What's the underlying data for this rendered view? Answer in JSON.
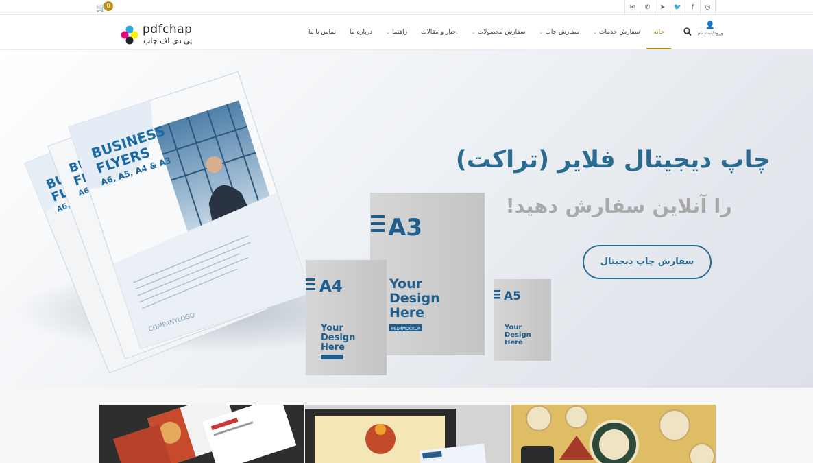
{
  "topbar": {
    "cart_count": "0",
    "social": [
      {
        "icon": "envelope-icon",
        "glyph": "✉"
      },
      {
        "icon": "phone-icon",
        "glyph": "✆"
      },
      {
        "icon": "telegram-icon",
        "glyph": "➤"
      },
      {
        "icon": "twitter-icon",
        "glyph": "🐦"
      },
      {
        "icon": "facebook-icon",
        "glyph": "f"
      },
      {
        "icon": "instagram-icon",
        "glyph": "◎"
      }
    ]
  },
  "header": {
    "logo_en": "pdfchap",
    "logo_fa": "پی دی اف چاپ",
    "nav": [
      {
        "label": "تماس با ما",
        "dropdown": false
      },
      {
        "label": "درباره ما",
        "dropdown": false
      },
      {
        "label": "راهنما",
        "dropdown": true
      },
      {
        "label": "اخبار و مقالات",
        "dropdown": false
      },
      {
        "label": "سفارش محصولات",
        "dropdown": true
      },
      {
        "label": "سفارش چاپ",
        "dropdown": true
      },
      {
        "label": "سفارش خدمات",
        "dropdown": true
      },
      {
        "label": "خانه",
        "dropdown": false,
        "active": true
      }
    ],
    "user_label": "ورود/ثبت نام"
  },
  "hero": {
    "title": "چاپ دیجیتال فلایر (تراکت)",
    "subtitle": "را آنلاین سفارش دهید!",
    "cta": "سفارش چاپ دیجیتال",
    "flyer_heading_1": "BUSINESS",
    "flyer_heading_2": "FLYERS",
    "flyer_sizes": "A6, A5, A4 & A3",
    "company_logo": "COMPANYLOGO",
    "mock_a3": "A3",
    "mock_a4": "A4",
    "mock_a5": "A5",
    "mock_text": "Your Design Here",
    "mock_tag": "PSD4MOCKUP"
  },
  "colors": {
    "accent": "#b88d18",
    "hero_blue": "#2a6b8f"
  }
}
